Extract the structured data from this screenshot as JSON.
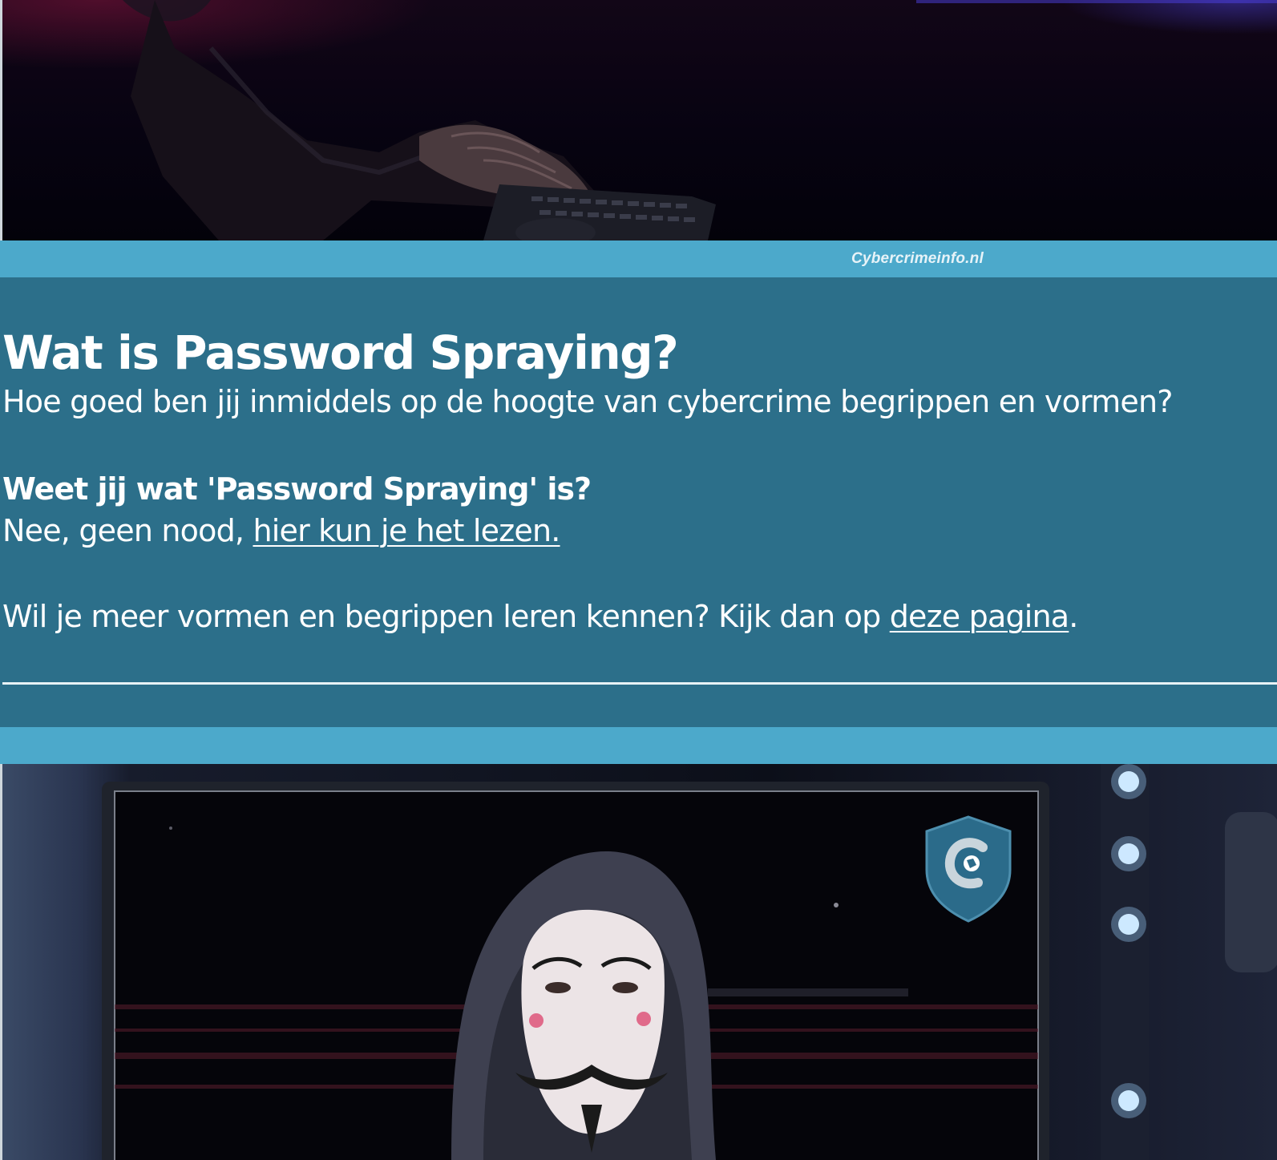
{
  "banner_watermark": "Cybercrimeinfo.nl",
  "article": {
    "title": "Wat is Password Spraying?",
    "subtitle": "Hoe goed ben jij inmiddels op de hoogte van cybercrime begrippen en vormen?",
    "question": "Weet jij wat 'Password Spraying' is?",
    "answer_prefix": "Nee, geen nood, ",
    "answer_link": "hier kun je het lezen.",
    "more_prefix": "Wil je meer vormen en begrippen leren kennen? Kijk dan op ",
    "more_link": "deze pagina",
    "more_suffix": "."
  },
  "logo": {
    "text": "Cybercrimeinfo.nl"
  },
  "colors": {
    "content_background": "#2c6f8a",
    "bar_color": "#4ca9cb",
    "text": "#ffffff"
  }
}
